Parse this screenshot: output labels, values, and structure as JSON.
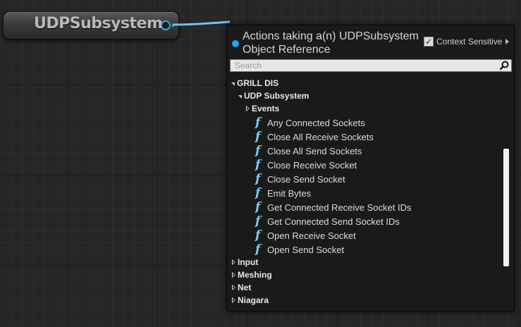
{
  "node": {
    "title": "UDPSubsystem"
  },
  "colors": {
    "pin": "#35a8e8",
    "menu_dot": "#25a3f0",
    "function_icon": "#7dcbf0"
  },
  "menu": {
    "title_line1": "Actions taking a(n) UDPSubsystem",
    "title_line2": "Object Reference",
    "context_sensitive_label": "Context Sensitive",
    "context_sensitive_checked": true,
    "search_placeholder": "Search",
    "tree": {
      "root": "GRILL DIS",
      "subcategory": "UDP Subsystem",
      "events": "Events",
      "functions": [
        "Any Connected Sockets",
        "Close All Receive Sockets",
        "Close All Send Sockets",
        "Close Receive Socket",
        "Close Send Socket",
        "Emit Bytes",
        "Get Connected Receive Socket IDs",
        "Get Connected Send Socket IDs",
        "Open Receive Socket",
        "Open Send Socket"
      ],
      "categories": [
        "Input",
        "Meshing",
        "Net",
        "Niagara"
      ]
    }
  },
  "icons": {
    "function": "f",
    "check": "✓"
  }
}
